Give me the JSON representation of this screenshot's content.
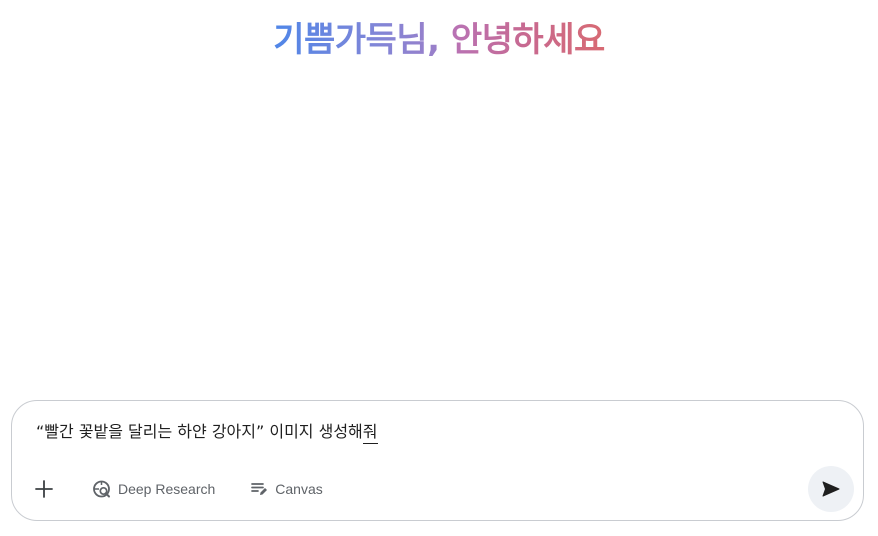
{
  "greeting": {
    "name_part": "기쁨가득님,",
    "hello_part": "안녕하세요"
  },
  "composer": {
    "prompt_text": "“빨간 꽃밭을 달리는 하얀 강아지” 이미지 생성해",
    "prompt_text_last_char": "줘",
    "tools": [
      {
        "label": "Deep Research",
        "icon": "deep-research-icon"
      },
      {
        "label": "Canvas",
        "icon": "canvas-icon"
      }
    ],
    "plus_icon": "plus-icon",
    "send_icon": "send-icon"
  },
  "colors": {
    "greeting_blue": "#4f86e8",
    "greeting_purple": "#9b7fc9",
    "greeting_pink": "#d86a73",
    "text_dark": "#1f1f1f",
    "text_muted": "#5f6368",
    "border": "#c9ccd1",
    "send_bg": "#eef1f5"
  }
}
